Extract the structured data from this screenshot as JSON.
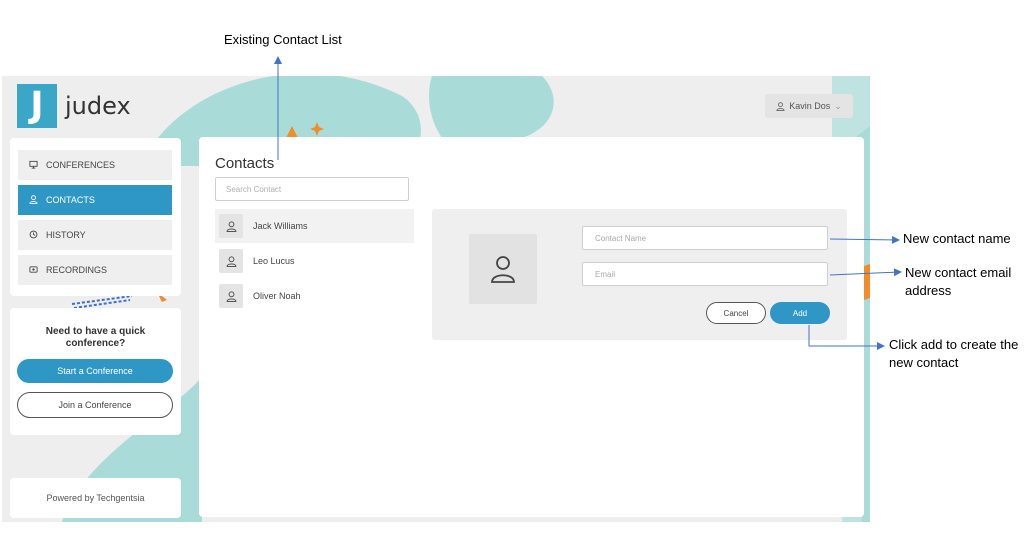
{
  "app": {
    "logo_letter": "J",
    "logo_text": "judex",
    "user_name": "Kavin Dos"
  },
  "sidebar": {
    "items": [
      {
        "label": "CONFERENCES",
        "icon": "monitor-icon",
        "active": false
      },
      {
        "label": "CONTACTS",
        "icon": "user-icon",
        "active": true
      },
      {
        "label": "HISTORY",
        "icon": "history-icon",
        "active": false
      },
      {
        "label": "RECORDINGS",
        "icon": "recording-icon",
        "active": false
      }
    ]
  },
  "quick": {
    "title": "Need to have a quick conference?",
    "start_label": "Start a Conference",
    "join_label": "Join a Conference"
  },
  "footer": {
    "powered": "Powered by Techgentsia"
  },
  "contacts": {
    "title": "Contacts",
    "search_placeholder": "Search Contact",
    "list": [
      {
        "name": "Jack Williams"
      },
      {
        "name": "Leo Lucus"
      },
      {
        "name": "Oliver Noah"
      }
    ]
  },
  "form": {
    "name_placeholder": "Contact Name",
    "email_placeholder": "Email",
    "cancel_label": "Cancel",
    "add_label": "Add"
  },
  "annotations": {
    "existing_list": "Existing Contact List",
    "new_name": "New contact name",
    "new_email_line1": "New contact email",
    "new_email_line2": "address",
    "click_add_line1": "Click add to create the",
    "click_add_line2": "new contact"
  },
  "colors": {
    "accent": "#2e97c6",
    "teal_bg": "#a9dcd9",
    "orange": "#f28c28",
    "arrow": "#4472c4"
  }
}
